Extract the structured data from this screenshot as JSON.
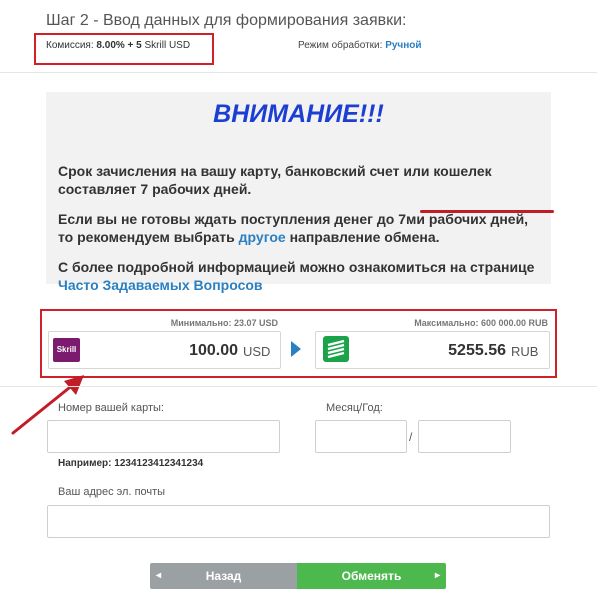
{
  "header": {
    "title": "Шаг 2 - Ввод данных для формирования заявки:",
    "commission_label": "Комиссия:",
    "commission_value": "8.00% + 5",
    "commission_currency": "Skrill USD",
    "mode_label": "Режим обработки:",
    "mode_value": "Ручной"
  },
  "notice": {
    "title": "ВНИМАНИЕ!!!",
    "p1": "Срок зачисления на вашу карту, банковский счет или кошелек составляет 7 рабочих дней.",
    "p2_before": "Если вы не готовы ждать поступления денег до 7ми рабочих дней, то рекомендуем выбрать ",
    "p2_link": "другое",
    "p2_after": " направление обмена.",
    "p3_before": "С более подробной информацией можно ознакомиться на странице ",
    "p3_link": "Часто Задаваемых Вопросов"
  },
  "exchange": {
    "min_label": "Минимально: 23.07 USD",
    "max_label": "Максимально: 600 000.00 RUB",
    "from_logo": "Skrill",
    "from_amount": "100.00",
    "from_currency": "USD",
    "to_amount": "5255.56",
    "to_currency": "RUB"
  },
  "form": {
    "card_label": "Номер вашей карты:",
    "card_value": "",
    "month_year_label": "Месяц/Год:",
    "month_value": "",
    "year_value": "",
    "separator": "/",
    "example": "Например: 1234123412341234",
    "email_label": "Ваш адрес эл. почты",
    "email_value": ""
  },
  "buttons": {
    "back_label": "Назад",
    "next_label": "Обменять",
    "back_chevron": "◂",
    "next_chevron": "▸"
  },
  "colors": {
    "accent_blue": "#2a7fc1",
    "warning_title": "#1d3fd1",
    "highlight_red": "#d0202a",
    "back_gray": "#9ba0a3",
    "next_green": "#4cb84d",
    "skrill_purple": "#7c1a6e",
    "sber_green": "#1ba34a"
  }
}
